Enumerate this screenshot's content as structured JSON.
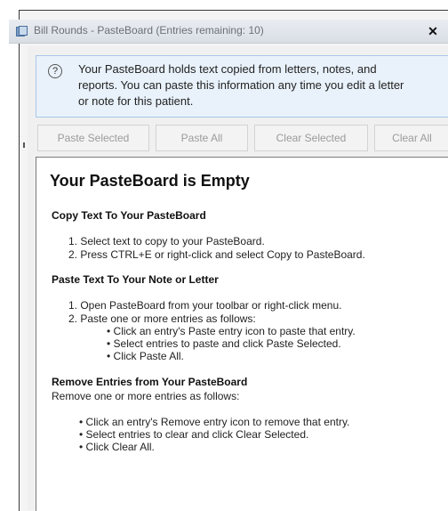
{
  "window": {
    "title": "Bill Rounds - PasteBoard (Entries remaining: 10)",
    "close_glyph": "✕"
  },
  "info": {
    "icon": "help-circle-icon",
    "lines": [
      "Your PasteBoard holds text copied from letters, notes, and",
      "reports. You can paste this information any time you edit a letter",
      "or note for this patient."
    ]
  },
  "toolbar": {
    "paste_selected": "Paste Selected",
    "paste_all": "Paste All",
    "clear_selected": "Clear Selected",
    "clear_all": "Clear All"
  },
  "content": {
    "heading": "Your PasteBoard is Empty",
    "copy_heading": "Copy Text To Your PasteBoard",
    "copy_steps": [
      "1.  Select text to copy to your PasteBoard.",
      "2.  Press CTRL+E or right-click and select Copy to PasteBoard."
    ],
    "paste_heading": "Paste Text To Your Note or Letter",
    "paste_steps": [
      "1.  Open PasteBoard from your toolbar or right-click menu.",
      "2.  Paste one or more entries as follows:"
    ],
    "paste_bullets": [
      "•  Click an entry's Paste entry icon to paste that entry.",
      "•  Select entries to paste and click Paste Selected.",
      "•  Click Paste All."
    ],
    "remove_heading": "Remove Entries from Your PasteBoard",
    "remove_intro": "Remove one or more entries as follows:",
    "remove_bullets": [
      "•  Click an entry's Remove entry icon to remove that entry.",
      "•  Select entries to clear and click Clear Selected.",
      "•  Click Clear All."
    ]
  },
  "colors": {
    "info_bg": "#e9f2fb",
    "disabled_text": "#9b9b9b"
  }
}
